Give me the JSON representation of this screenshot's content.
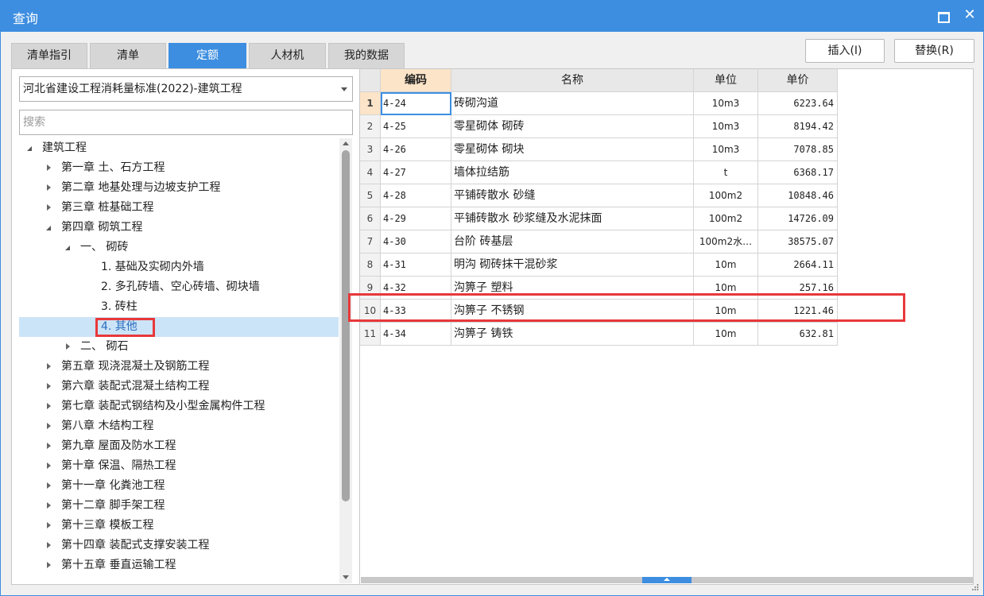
{
  "window": {
    "title": "查询"
  },
  "tabs": [
    {
      "label": "清单指引",
      "active": false
    },
    {
      "label": "清单",
      "active": false
    },
    {
      "label": "定额",
      "active": true
    },
    {
      "label": "人材机",
      "active": false
    },
    {
      "label": "我的数据",
      "active": false
    }
  ],
  "actions": {
    "insert_label": "插入(I)",
    "replace_label": "替换(R)"
  },
  "selector": {
    "value": "河北省建设工程消耗量标准(2022)-建筑工程"
  },
  "search": {
    "placeholder": "搜索",
    "value": ""
  },
  "tree": [
    {
      "label": "建筑工程",
      "level": 0,
      "state": "expanded"
    },
    {
      "label": "第一章 土、石方工程",
      "level": 1,
      "state": "collapsed"
    },
    {
      "label": "第二章 地基处理与边坡支护工程",
      "level": 1,
      "state": "collapsed"
    },
    {
      "label": "第三章 桩基础工程",
      "level": 1,
      "state": "collapsed"
    },
    {
      "label": "第四章 砌筑工程",
      "level": 1,
      "state": "expanded"
    },
    {
      "label": "一、 砌砖",
      "level": 2,
      "state": "expanded"
    },
    {
      "label": "1. 基础及实砌内外墙",
      "level": 3,
      "state": "leaf"
    },
    {
      "label": "2. 多孔砖墙、空心砖墙、砌块墙",
      "level": 3,
      "state": "leaf"
    },
    {
      "label": "3. 砖柱",
      "level": 3,
      "state": "leaf"
    },
    {
      "label": "4. 其他",
      "level": 3,
      "state": "leaf",
      "selected": true
    },
    {
      "label": "二、 砌石",
      "level": 2,
      "state": "collapsed"
    },
    {
      "label": "第五章 现浇混凝土及钢筋工程",
      "level": 1,
      "state": "collapsed"
    },
    {
      "label": "第六章 装配式混凝土结构工程",
      "level": 1,
      "state": "collapsed"
    },
    {
      "label": "第七章 装配式钢结构及小型金属构件工程",
      "level": 1,
      "state": "collapsed"
    },
    {
      "label": "第八章 木结构工程",
      "level": 1,
      "state": "collapsed"
    },
    {
      "label": "第九章 屋面及防水工程",
      "level": 1,
      "state": "collapsed"
    },
    {
      "label": "第十章 保温、隔热工程",
      "level": 1,
      "state": "collapsed"
    },
    {
      "label": "第十一章 化粪池工程",
      "level": 1,
      "state": "collapsed"
    },
    {
      "label": "第十二章 脚手架工程",
      "level": 1,
      "state": "collapsed"
    },
    {
      "label": "第十三章 模板工程",
      "level": 1,
      "state": "collapsed"
    },
    {
      "label": "第十四章 装配式支撑安装工程",
      "level": 1,
      "state": "collapsed"
    },
    {
      "label": "第十五章 垂直运输工程",
      "level": 1,
      "state": "collapsed"
    }
  ],
  "table": {
    "columns": [
      "编码",
      "名称",
      "单位",
      "单价"
    ],
    "rows": [
      {
        "n": "1",
        "code": "4-24",
        "name": "砖砌沟道",
        "unit": "10m3",
        "price": "6223.64"
      },
      {
        "n": "2",
        "code": "4-25",
        "name": "零星砌体 砌砖",
        "unit": "10m3",
        "price": "8194.42"
      },
      {
        "n": "3",
        "code": "4-26",
        "name": "零星砌体 砌块",
        "unit": "10m3",
        "price": "7078.85"
      },
      {
        "n": "4",
        "code": "4-27",
        "name": "墙体拉结筋",
        "unit": "t",
        "price": "6368.17"
      },
      {
        "n": "5",
        "code": "4-28",
        "name": "平铺砖散水 砂缝",
        "unit": "100m2",
        "price": "10848.46"
      },
      {
        "n": "6",
        "code": "4-29",
        "name": "平铺砖散水 砂浆缝及水泥抹面",
        "unit": "100m2",
        "price": "14726.09"
      },
      {
        "n": "7",
        "code": "4-30",
        "name": "台阶 砖基层",
        "unit": "100m2水…",
        "price": "38575.07"
      },
      {
        "n": "8",
        "code": "4-31",
        "name": "明沟 砌砖抹干混砂浆",
        "unit": "10m",
        "price": "2664.11"
      },
      {
        "n": "9",
        "code": "4-32",
        "name": "沟箅子 塑料",
        "unit": "10m",
        "price": "257.16"
      },
      {
        "n": "10",
        "code": "4-33",
        "name": "沟箅子 不锈钢",
        "unit": "10m",
        "price": "1221.46"
      },
      {
        "n": "11",
        "code": "4-34",
        "name": "沟箅子 铸铁",
        "unit": "10m",
        "price": "632.81"
      }
    ]
  },
  "colors": {
    "accent": "#3d8ee0",
    "highlight_box": "#e8383a",
    "selected_row": "#cce4f7",
    "code_header": "#fce4c8"
  }
}
